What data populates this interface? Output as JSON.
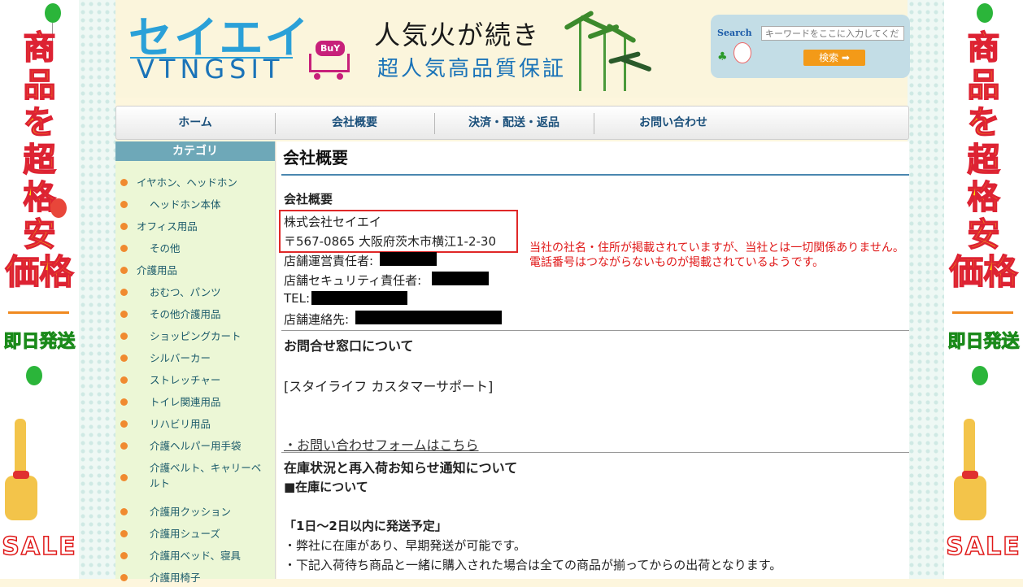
{
  "side_banner": {
    "vertical_text": [
      "商",
      "品",
      "を",
      "超",
      "格",
      "安"
    ],
    "price_text": "価格",
    "sokujitsu": "即日発送",
    "sale": "SALE"
  },
  "header": {
    "logo_jp": "セイエイ",
    "logo_en": "VTNGSIT",
    "cart_badge": "BuY",
    "tagline1": "人気火が続き",
    "tagline2": "超人気高品質保証",
    "search": {
      "label": "Search",
      "placeholder": "キーワードをここに入力してくださ",
      "button": "検索 ➡"
    }
  },
  "nav": {
    "items": [
      "ホーム",
      "会社概要",
      "決済・配送・返品",
      "お問い合わせ"
    ]
  },
  "sidebar": {
    "title": "カテゴリ",
    "items": [
      {
        "label": "イヤホン、ヘッドホン",
        "level": 0
      },
      {
        "label": "ヘッドホン本体",
        "level": 1
      },
      {
        "label": "オフィス用品",
        "level": 0
      },
      {
        "label": "その他",
        "level": 1
      },
      {
        "label": "介護用品",
        "level": 0
      },
      {
        "label": "おむつ、パンツ",
        "level": 1
      },
      {
        "label": "その他介護用品",
        "level": 1
      },
      {
        "label": "ショッピングカート",
        "level": 1
      },
      {
        "label": "シルバーカー",
        "level": 1
      },
      {
        "label": "ストレッチャー",
        "level": 1
      },
      {
        "label": "トイレ関連用品",
        "level": 1
      },
      {
        "label": "リハビリ用品",
        "level": 1
      },
      {
        "label": "介護ヘルパー用手袋",
        "level": 1
      },
      {
        "label": "介護ベルト、キャリーベルト",
        "level": 1
      },
      {
        "label": "介護用クッション",
        "level": 1
      },
      {
        "label": "介護用シューズ",
        "level": 1
      },
      {
        "label": "介護用ベッド、寝具",
        "level": 1
      },
      {
        "label": "介護用椅子",
        "level": 1
      }
    ]
  },
  "main": {
    "page_title": "会社概要",
    "section_heading": "会社概要",
    "company_name": "株式会社セイエイ",
    "address": "〒567-0865 大阪府茨木市横江1-2-30",
    "manager_label": "店舗運営責任者:",
    "security_label": "店舗セキュリティ責任者:",
    "tel_label": "TEL:",
    "contact_label": "店舗連絡先:",
    "note_line1": "当社の社名・住所が掲載されていますが、当社とは一切関係ありません。",
    "note_line2": "電話番号はつながらないものが掲載されているようです。",
    "inquiry_heading": "お問合せ窓口について",
    "support_name": "[スタイライフ カスタマーサポート]",
    "inquiry_link": "・お問い合わせフォームはこちら",
    "stock_heading": "在庫状況と再入荷お知らせ通知について",
    "stock_sub": "■在庫について",
    "ship_heading": "「1日～2日以内に発送予定」",
    "ship_line1": "・弊社に在庫があり、早期発送が可能です。",
    "ship_line2": "・下記入荷待ち商品と一緒に購入された場合は全ての商品が揃ってからの出荷となります。"
  },
  "colors": {
    "accent_blue": "#2aa0d8",
    "note_red": "#e01818",
    "sidebar_title": "#6ea8b8",
    "bullet_orange": "#f08a30"
  }
}
